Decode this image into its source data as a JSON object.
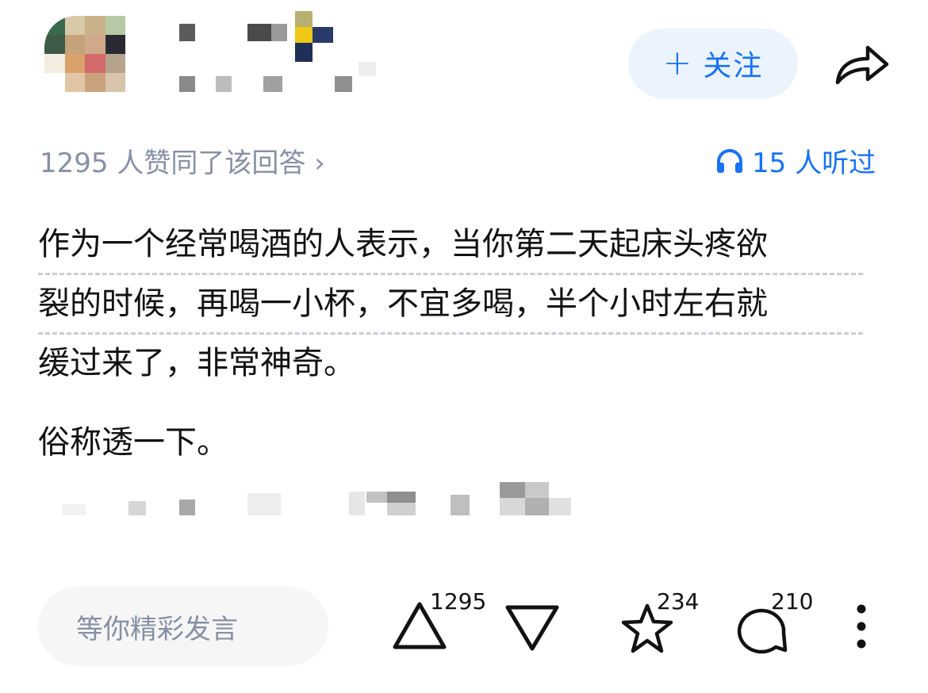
{
  "header": {
    "follow_label": "关注",
    "follow_icon": "plus-icon",
    "share_icon": "share-icon"
  },
  "meta": {
    "upvote_summary": "1295 人赞同了该回答 ›",
    "listened_icon": "headphones-icon",
    "listened_text": "15 人听过"
  },
  "answer": {
    "line1": "作为一个经常喝酒的人表示，当你第二天起床头疼欲",
    "line2": "裂的时候，再喝一小杯，不宜多喝，半个小时左右就",
    "line3": "缓过来了，非常神奇。",
    "para2": "俗称透一下。"
  },
  "bottom_bar": {
    "comment_placeholder": "等你精彩发言",
    "upvote_count": "1295",
    "favorite_count": "234",
    "comment_count": "210",
    "icons": [
      "upvote-icon",
      "downvote-icon",
      "star-icon",
      "comment-icon",
      "more-icon"
    ]
  },
  "colors": {
    "accent": "#1772f6",
    "accent_bg": "#ebf3ff",
    "meta_gray": "#8590a6",
    "text": "#121212"
  }
}
